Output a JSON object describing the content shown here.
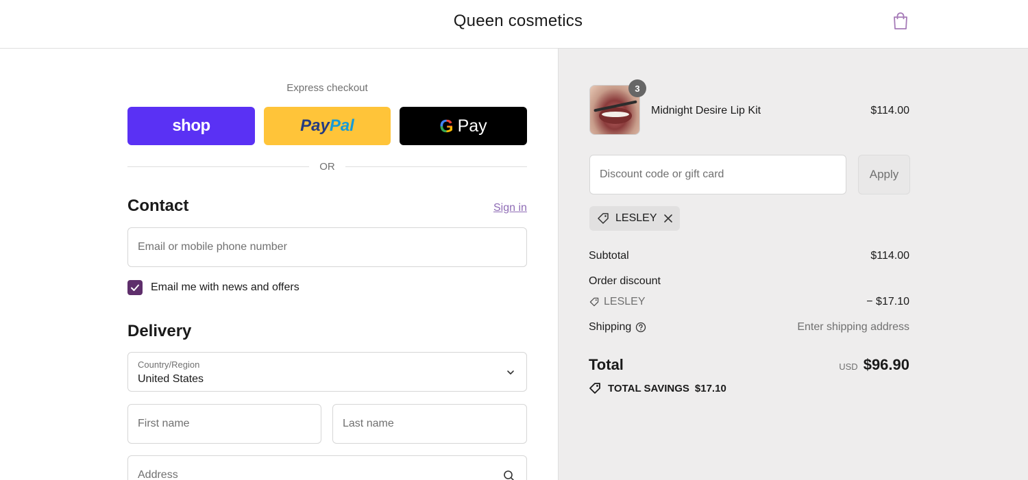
{
  "header": {
    "store_name": "Queen cosmetics"
  },
  "express": {
    "label": "Express checkout",
    "shop_label": "shop",
    "paypal_part1": "Pay",
    "paypal_part2": "Pal",
    "gpay_g": "G",
    "gpay_label": "Pay",
    "or_label": "OR"
  },
  "contact": {
    "title": "Contact",
    "signin_label": "Sign in",
    "email_placeholder": "Email or mobile phone number",
    "newsletter_label": "Email me with news and offers",
    "newsletter_checked": true
  },
  "delivery": {
    "title": "Delivery",
    "country_label": "Country/Region",
    "country_value": "United States",
    "first_name_placeholder": "First name",
    "last_name_placeholder": "Last name",
    "address_placeholder": "Address"
  },
  "summary": {
    "product": {
      "name": "Midnight Desire Lip Kit",
      "price": "$114.00",
      "quantity": "3"
    },
    "discount_placeholder": "Discount code or gift card",
    "apply_label": "Apply",
    "applied_code": "LESLEY",
    "subtotal_label": "Subtotal",
    "subtotal_value": "$114.00",
    "order_discount_label": "Order discount",
    "discount_code": "LESLEY",
    "discount_value": "− $17.10",
    "shipping_label": "Shipping",
    "shipping_value": "Enter shipping address",
    "total_label": "Total",
    "currency": "USD",
    "total_value": "$96.90",
    "savings_label": "TOTAL SAVINGS",
    "savings_value": "$17.10"
  },
  "colors": {
    "accent": "#5e2e6b",
    "shop_purple": "#5a31f4",
    "paypal_yellow": "#ffc439",
    "summary_bg": "#eeeded"
  }
}
